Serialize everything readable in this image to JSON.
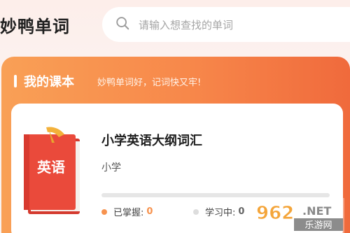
{
  "header": {
    "app_title": "妙鸭单词",
    "search": {
      "placeholder": "请输入想查找的单词",
      "icon": "search-icon"
    }
  },
  "section": {
    "title": "我的课本",
    "subtitle": "妙鸭单词好，记词快又牢!"
  },
  "textbook": {
    "cover_label": "英语",
    "title": "小学英语大纲词汇",
    "level": "小学",
    "progress": 0,
    "mastered_label": "已掌握:",
    "mastered_value": "0",
    "learning_label": "学习中:",
    "learning_value": "0"
  },
  "watermark": {
    "number": "962",
    "suffix": ".NET",
    "caption": "乐游网"
  },
  "colors": {
    "accent": "#f7874a",
    "accent_light": "#f9a056",
    "accent_dark": "#f06a3c",
    "book_red": "#e8473a",
    "ribbon": "#f3b13a"
  }
}
